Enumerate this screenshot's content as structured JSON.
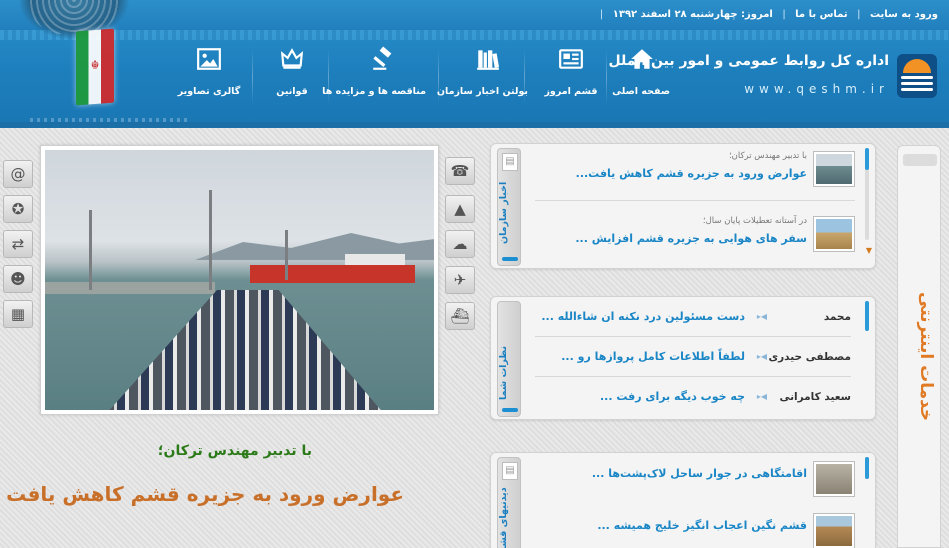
{
  "topbar": {
    "login": "ورود به سایت",
    "contact": "تماس با ما",
    "today": "امروز: چهارشنبه ۲۸ اسفند ۱۳۹۲",
    "sep": "|"
  },
  "brand": {
    "title": "اداره کل روابط عمومی و امور بین الملل",
    "url": "www.qeshm.ir"
  },
  "nav": [
    {
      "label": "صفحه اصلی",
      "icon": "home-icon"
    },
    {
      "label": "قشم امروز",
      "icon": "newspaper-icon"
    },
    {
      "label": "بولتن اخبار سازمان",
      "icon": "books-icon"
    },
    {
      "label": "مناقصه ها و مزایده ها",
      "icon": "gavel-icon"
    },
    {
      "label": "قوانین",
      "icon": "crown-icon"
    },
    {
      "label": "گالری تصاویر",
      "icon": "picture-icon"
    }
  ],
  "left_icons": [
    "at-icon",
    "compass-icon",
    "exchange-icon",
    "support-icon",
    "calendar-icon"
  ],
  "center_icons": [
    "phone-icon",
    "map-icon",
    "cloud-icon",
    "airplane-icon",
    "ship-icon"
  ],
  "hero": {
    "subtitle": "با تدبیر مهندس ترکان؛",
    "title": "عوارض ورود به جزیره قشم کاهش یافت"
  },
  "news_panel": {
    "tab_label": "اخبار سازمان",
    "items": [
      {
        "meta": "با تدبیر مهندس ترکان؛",
        "title": "عوارض ورود به جزیره قشم کاهش یافت..."
      },
      {
        "meta": "در آستانه تعطیلات پایان سال؛",
        "title": "سفر های هوایی به جزیره قشم افزایش ..."
      }
    ]
  },
  "comments_panel": {
    "tab_label": "نظرات شما",
    "items": [
      {
        "name": "محمد",
        "text": "دست مسئولین درد نکنه ان شاءالله ..."
      },
      {
        "name": "مصطفی حیدری",
        "text": "لطفاً اطلاعات کامل پروازها رو ..."
      },
      {
        "name": "سعید کامرانی",
        "text": "چه خوب دیگه برای رفت ..."
      }
    ]
  },
  "qeshm_panel": {
    "tab_label": "دیدنیهای قشم",
    "items": [
      {
        "title": "اقامتگاهی در جوار ساحل لاک‌پشت‌ها ..."
      },
      {
        "title": "قشم نگین اعجاب انگیز خلیج همیشه ..."
      }
    ]
  },
  "services": {
    "label": "خدمات اینترنتی"
  },
  "colors": {
    "header_blue": "#1e7fbd",
    "link_blue": "#1a86c6",
    "accent_orange": "#e07a24",
    "caption_green": "#2b7a18"
  }
}
